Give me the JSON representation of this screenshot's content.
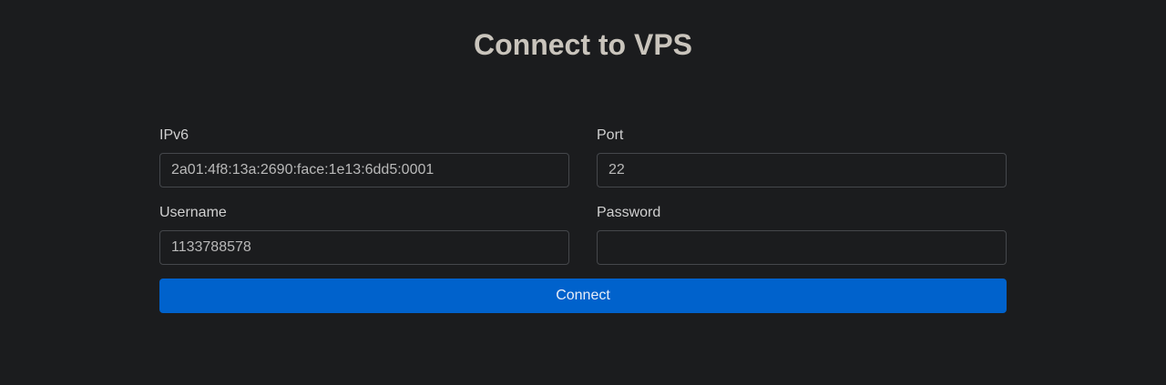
{
  "page": {
    "title": "Connect to VPS"
  },
  "form": {
    "ipv6": {
      "label": "IPv6",
      "value": "2a01:4f8:13a:2690:face:1e13:6dd5:0001"
    },
    "port": {
      "label": "Port",
      "value": "22"
    },
    "username": {
      "label": "Username",
      "value": "1133788578"
    },
    "password": {
      "label": "Password",
      "value": ""
    },
    "connect_label": "Connect"
  },
  "colors": {
    "background": "#1b1c1e",
    "accent": "#0062cc"
  }
}
